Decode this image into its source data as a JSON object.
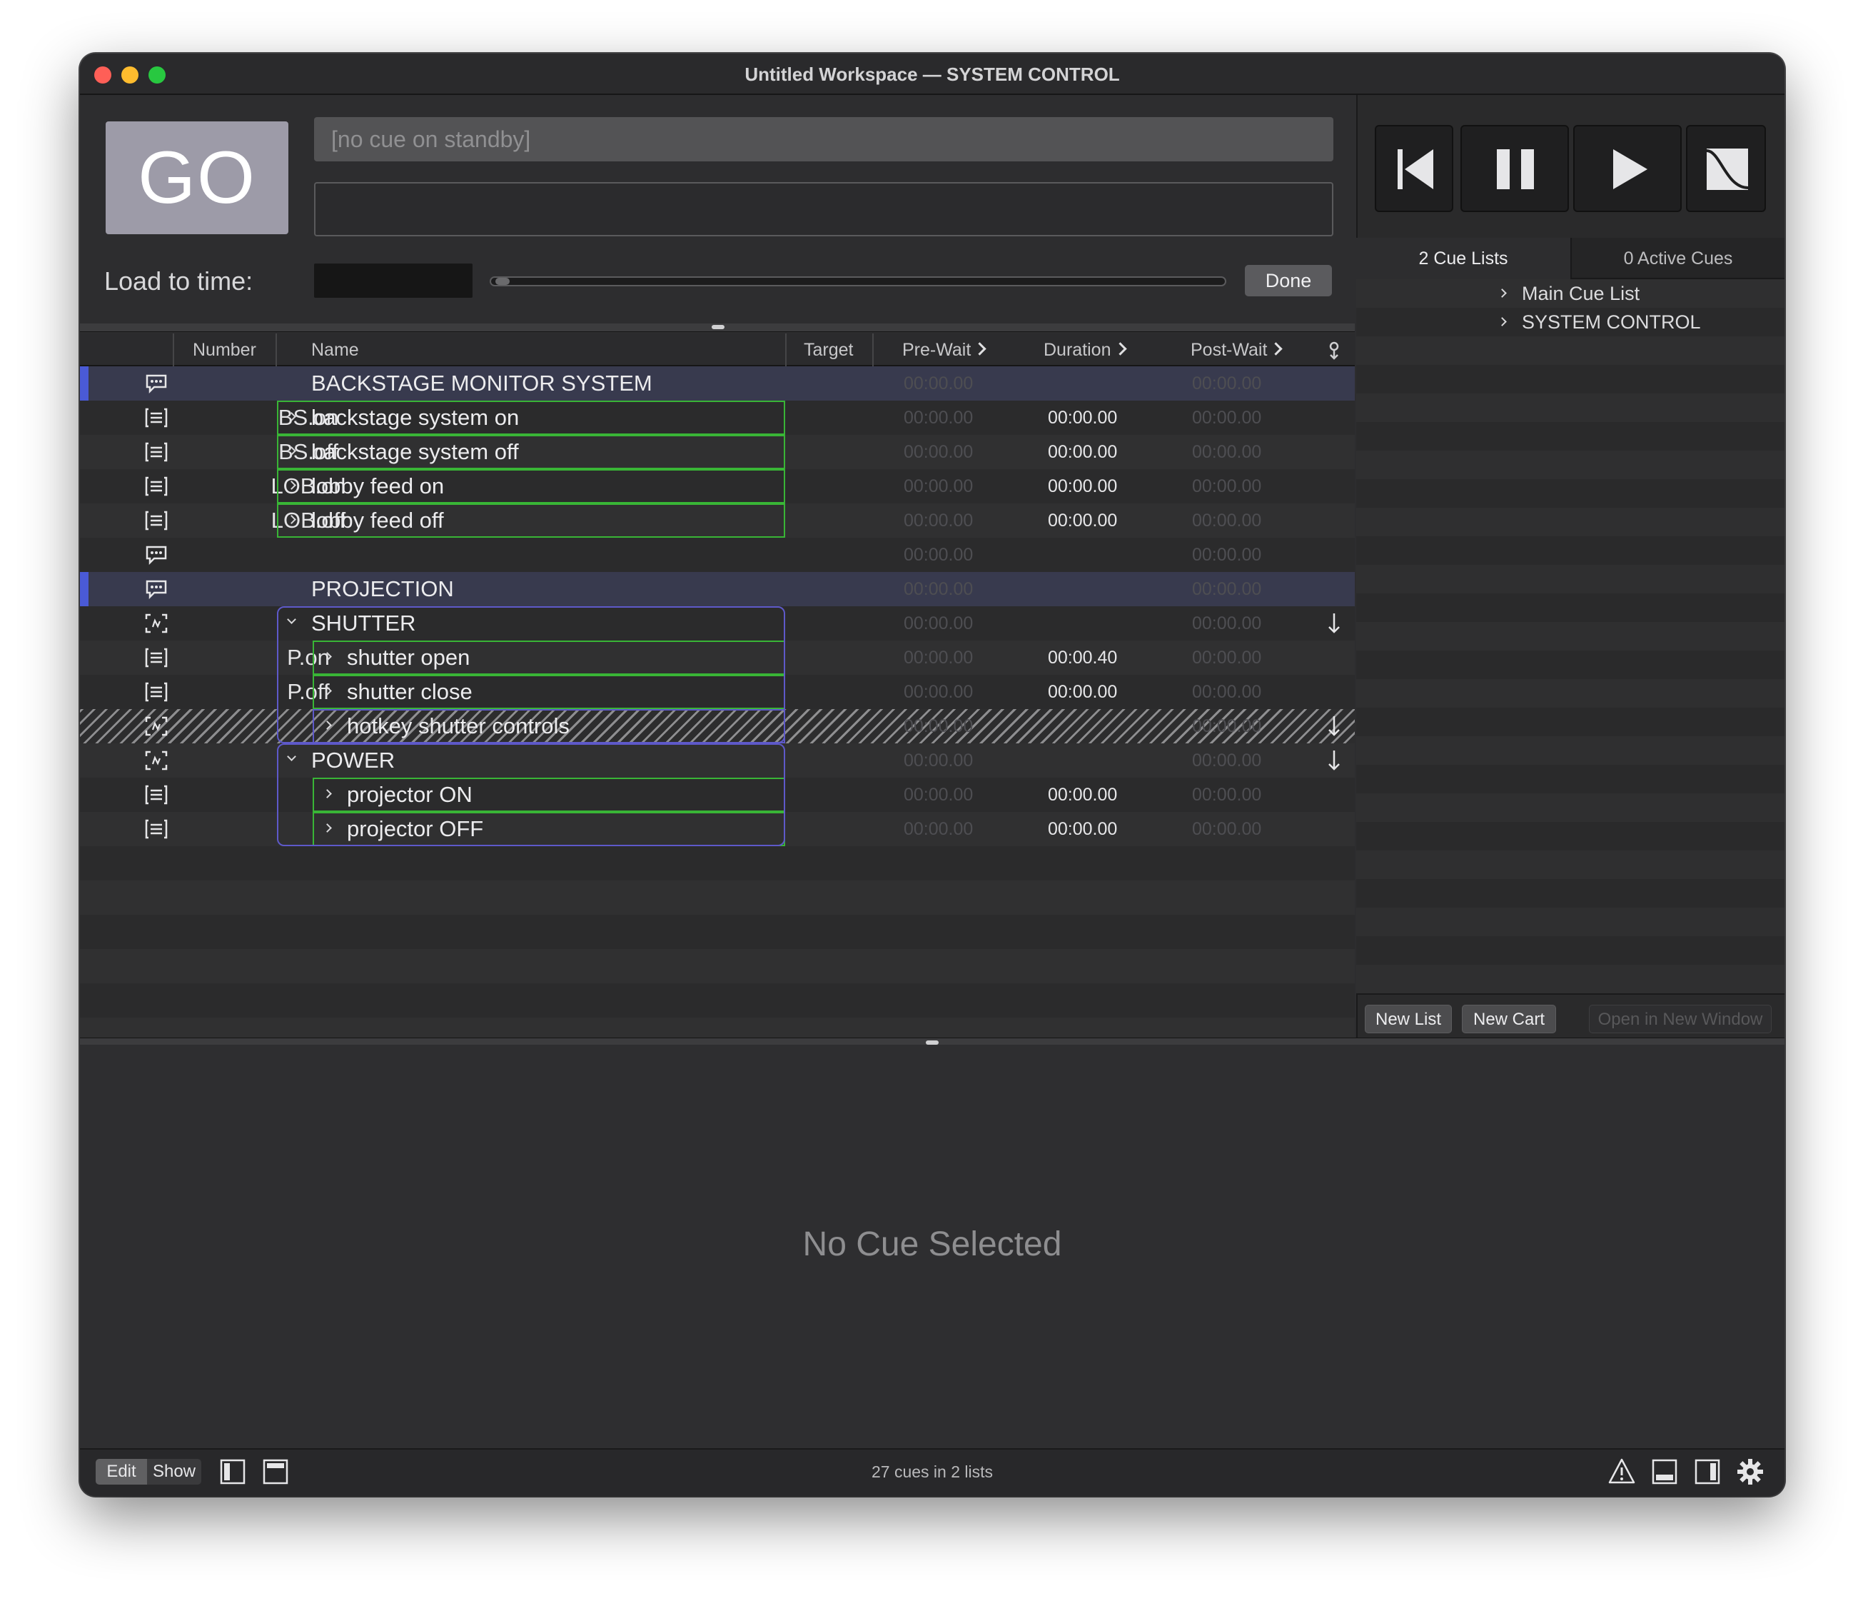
{
  "window": {
    "title": "Untitled Workspace — SYSTEM CONTROL"
  },
  "top": {
    "go_label": "GO",
    "standby_text": "[no cue on standby]",
    "load_label": "Load to time:",
    "done_label": "Done"
  },
  "columns": {
    "number": "Number",
    "name": "Name",
    "target": "Target",
    "prewait": "Pre-Wait",
    "duration": "Duration",
    "postwait": "Post-Wait"
  },
  "cues": [
    {
      "number": "",
      "name": "BACKSTAGE MONITOR SYSTEM",
      "prewait": "00:00.00",
      "duration": "",
      "postwait": "00:00.00",
      "icon": "memo-icon"
    },
    {
      "number": "BS.on",
      "name": "backstage system on",
      "prewait": "00:00.00",
      "duration": "00:00.00",
      "postwait": "00:00.00",
      "icon": "network-cue-icon"
    },
    {
      "number": "BS.off",
      "name": "backstage system off",
      "prewait": "00:00.00",
      "duration": "00:00.00",
      "postwait": "00:00.00",
      "icon": "network-cue-icon"
    },
    {
      "number": "LOB.on",
      "name": "lobby feed on",
      "prewait": "00:00.00",
      "duration": "00:00.00",
      "postwait": "00:00.00",
      "icon": "network-cue-icon"
    },
    {
      "number": "LOB.off",
      "name": "lobby feed off",
      "prewait": "00:00.00",
      "duration": "00:00.00",
      "postwait": "00:00.00",
      "icon": "network-cue-icon"
    },
    {
      "number": "",
      "name": "",
      "prewait": "00:00.00",
      "duration": "",
      "postwait": "00:00.00",
      "icon": "memo-icon"
    },
    {
      "number": "",
      "name": "PROJECTION",
      "prewait": "00:00.00",
      "duration": "",
      "postwait": "00:00.00",
      "icon": "memo-icon"
    },
    {
      "number": "",
      "name": "SHUTTER",
      "prewait": "00:00.00",
      "duration": "",
      "postwait": "00:00.00",
      "icon": "group-cue-icon"
    },
    {
      "number": "P.on",
      "name": "shutter open",
      "prewait": "00:00.00",
      "duration": "00:00.40",
      "postwait": "00:00.00",
      "icon": "network-cue-icon"
    },
    {
      "number": "P.off",
      "name": "shutter close",
      "prewait": "00:00.00",
      "duration": "00:00.00",
      "postwait": "00:00.00",
      "icon": "network-cue-icon"
    },
    {
      "number": "",
      "name": "hotkey shutter controls",
      "prewait": "00:00.00",
      "duration": "",
      "postwait": "00:00.00",
      "icon": "group-cue-icon"
    },
    {
      "number": "",
      "name": "POWER",
      "prewait": "00:00.00",
      "duration": "",
      "postwait": "00:00.00",
      "icon": "group-cue-icon"
    },
    {
      "number": "",
      "name": "projector ON",
      "prewait": "00:00.00",
      "duration": "00:00.00",
      "postwait": "00:00.00",
      "icon": "network-cue-icon"
    },
    {
      "number": "",
      "name": "projector OFF",
      "prewait": "00:00.00",
      "duration": "00:00.00",
      "postwait": "00:00.00",
      "icon": "network-cue-icon"
    }
  ],
  "sidebar": {
    "tab_lists": "2 Cue Lists",
    "tab_active": "0 Active Cues",
    "cue_lists": [
      "Main Cue List",
      "SYSTEM CONTROL"
    ],
    "new_list": "New List",
    "new_cart": "New Cart",
    "open_window": "Open in New Window"
  },
  "inspector": {
    "empty_text": "No Cue Selected"
  },
  "status": {
    "edit": "Edit",
    "show": "Show",
    "summary": "27 cues in 2 lists"
  },
  "colors": {
    "selected_group_border": "#5e59c9",
    "cue_outline": "#39b536",
    "row_marker": "#4a5ad6"
  }
}
